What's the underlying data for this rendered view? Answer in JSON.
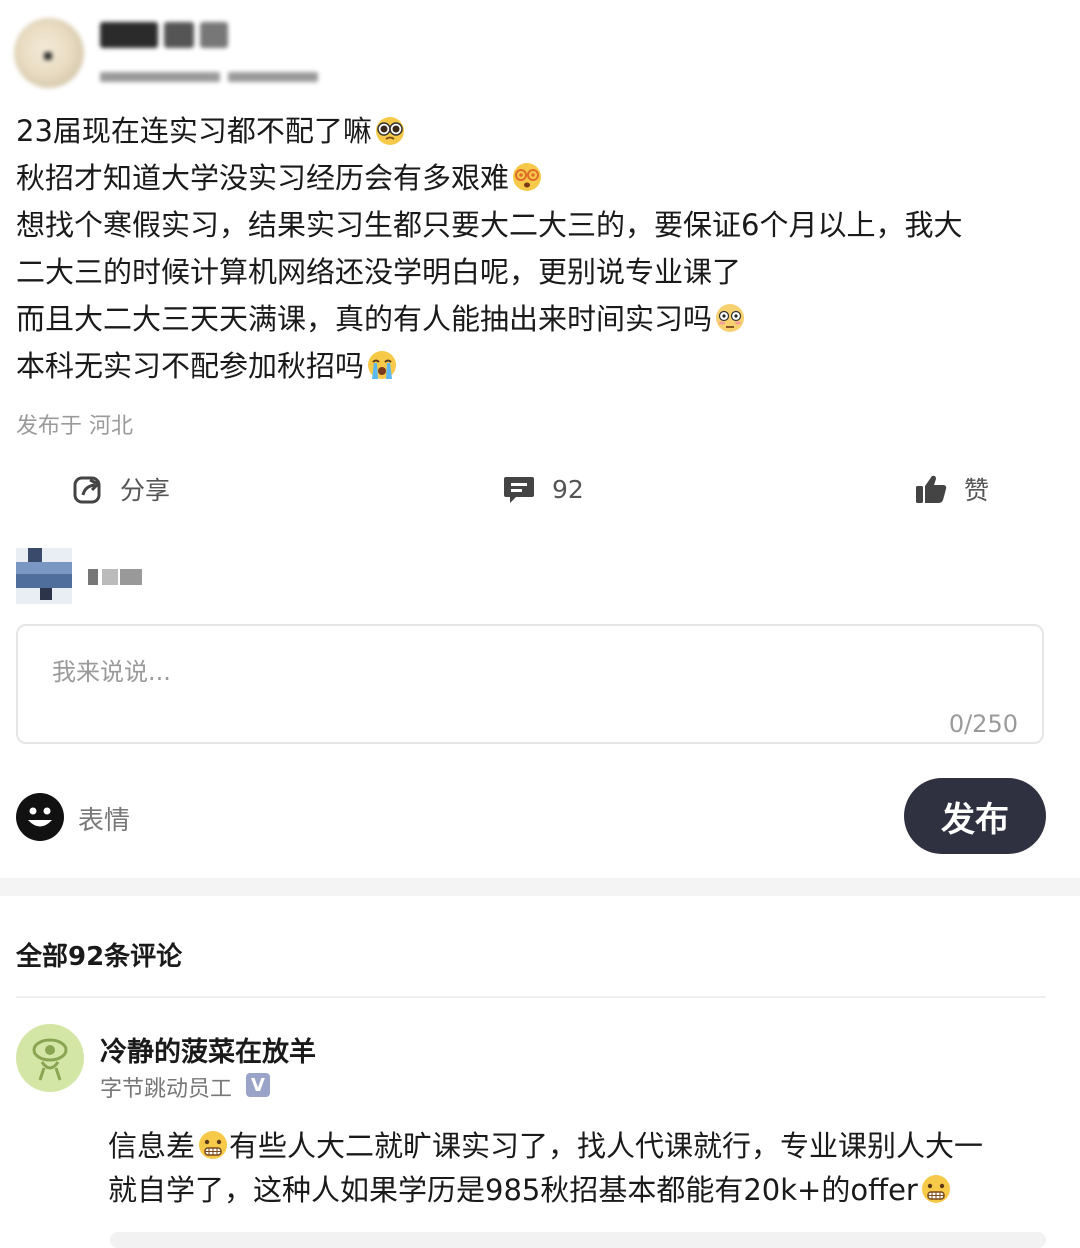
{
  "author": {
    "name": "",
    "meta": ""
  },
  "post": {
    "lines": [
      "23届现在连实习都不配了嘛",
      "秋招才知道大学没实习经历会有多艰难",
      "想找个寒假实习，结果实习生都只要大二大三的，要保证6个月以上，我大",
      "二大三的时候计算机网络还没学明白呢，更别说专业课了",
      "而且大二大三天天满课，真的有人能抽出来时间实习吗",
      "本科无实习不配参加秋招吗"
    ],
    "emojis": [
      "pleading-face",
      "dizzy-face",
      "flushed-face",
      "crying-face"
    ],
    "location": "发布于 河北"
  },
  "actions": {
    "share_label": "分享",
    "comment_count": "92",
    "like_label": "赞"
  },
  "composer": {
    "placeholder": "我来说说...",
    "counter": "0/250",
    "emoji_label": "表情",
    "publish_label": "发布"
  },
  "comments": {
    "header": "全部92条评论",
    "items": [
      {
        "name": "冷静的菠菜在放羊",
        "role": "字节跳动员工",
        "verified_mark": "V",
        "lines": [
          "信息差",
          "有些人大二就旷课实习了，找人代课就行，专业课别人大一",
          "就自学了，这种人如果学历是985秋招基本都能有20k+的offer"
        ],
        "emoji": "grimacing-face"
      }
    ]
  }
}
